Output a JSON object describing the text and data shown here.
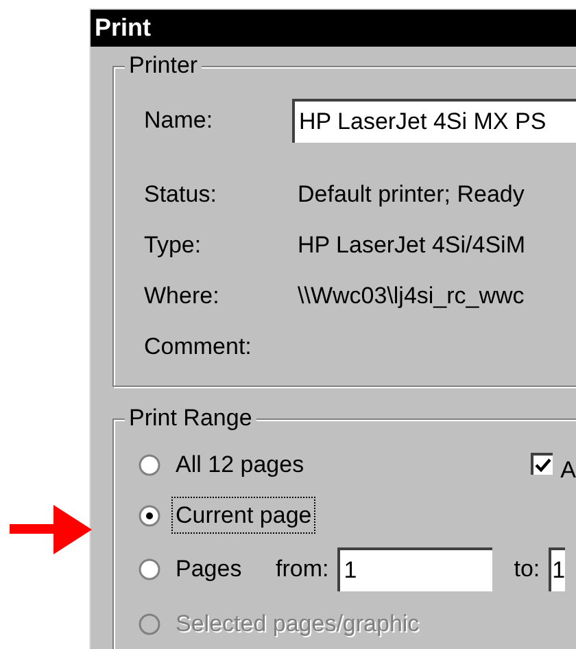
{
  "window": {
    "title": "Print"
  },
  "printer": {
    "title": "Printer",
    "name_label": "Name:",
    "name_value": "HP LaserJet 4Si MX PS",
    "info": [
      {
        "label": "Status:",
        "value": "Default printer; Ready"
      },
      {
        "label": "Type:",
        "value": "HP LaserJet 4Si/4SiM"
      },
      {
        "label": "Where:",
        "value": "\\\\Wwc03\\lj4si_rc_wwc"
      },
      {
        "label": "Comment:"
      }
    ]
  },
  "print_range": {
    "title": "Print Range",
    "options": [
      {
        "label": "All 12 pages",
        "selected": false,
        "disabled": false,
        "focused": false
      },
      {
        "label": "Current page",
        "selected": true,
        "disabled": false,
        "focused": true
      },
      {
        "label": "Pages",
        "selected": false,
        "disabled": false,
        "focused": false
      },
      {
        "label": "Selected pages/graphic",
        "selected": false,
        "disabled": true,
        "focused": false
      }
    ],
    "checkbox": {
      "label": "A",
      "checked": true
    },
    "from": {
      "label": "from:",
      "value": "1"
    },
    "to": {
      "label": "to:",
      "value": "1"
    }
  }
}
